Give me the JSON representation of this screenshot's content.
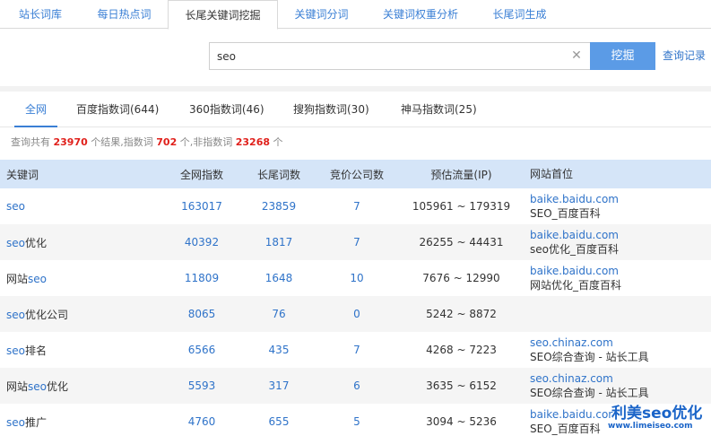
{
  "top_tabs": [
    {
      "label": "站长词库",
      "active": false
    },
    {
      "label": "每日热点词",
      "active": false
    },
    {
      "label": "长尾关键词挖掘",
      "active": true
    },
    {
      "label": "关键词分词",
      "active": false
    },
    {
      "label": "关键词权重分析",
      "active": false
    },
    {
      "label": "长尾词生成",
      "active": false
    }
  ],
  "search": {
    "value": "seo",
    "button_label": "挖掘",
    "history_label": "查询记录"
  },
  "sub_tabs": [
    {
      "label": "全网",
      "active": true
    },
    {
      "label": "百度指数词(644)",
      "active": false
    },
    {
      "label": "360指数词(46)",
      "active": false
    },
    {
      "label": "搜狗指数词(30)",
      "active": false
    },
    {
      "label": "神马指数词(25)",
      "active": false
    }
  ],
  "summary": {
    "prefix": "查询共有",
    "total": "23970",
    "mid1": "个结果,指数词",
    "index_count": "702",
    "mid2": "个,非指数词",
    "non_index_count": "23268",
    "suffix": "个"
  },
  "table": {
    "headers": [
      "关键词",
      "全网指数",
      "长尾词数",
      "竞价公司数",
      "预估流量(IP)",
      "网站首位"
    ],
    "rows": [
      {
        "kw_pre": "",
        "kw_hl": "seo",
        "kw_post": "",
        "index": "163017",
        "longtail": "23859",
        "bid": "7",
        "flow": "105961 ~ 179319",
        "domain": "baike.baidu.com",
        "site_title": "SEO_百度百科"
      },
      {
        "kw_pre": "",
        "kw_hl": "seo",
        "kw_post": "优化",
        "index": "40392",
        "longtail": "1817",
        "bid": "7",
        "flow": "26255 ~ 44431",
        "domain": "baike.baidu.com",
        "site_title": "seo优化_百度百科"
      },
      {
        "kw_pre": "网站",
        "kw_hl": "seo",
        "kw_post": "",
        "index": "11809",
        "longtail": "1648",
        "bid": "10",
        "flow": "7676 ~ 12990",
        "domain": "baike.baidu.com",
        "site_title": "网站优化_百度百科"
      },
      {
        "kw_pre": "",
        "kw_hl": "seo",
        "kw_post": "优化公司",
        "index": "8065",
        "longtail": "76",
        "bid": "0",
        "flow": "5242 ~ 8872",
        "domain": "",
        "site_title": ""
      },
      {
        "kw_pre": "",
        "kw_hl": "seo",
        "kw_post": "排名",
        "index": "6566",
        "longtail": "435",
        "bid": "7",
        "flow": "4268 ~ 7223",
        "domain": "seo.chinaz.com",
        "site_title": "SEO综合查询 - 站长工具"
      },
      {
        "kw_pre": "网站",
        "kw_hl": "seo",
        "kw_post": "优化",
        "index": "5593",
        "longtail": "317",
        "bid": "6",
        "flow": "3635 ~ 6152",
        "domain": "seo.chinaz.com",
        "site_title": "SEO综合查询 - 站长工具"
      },
      {
        "kw_pre": "",
        "kw_hl": "seo",
        "kw_post": "推广",
        "index": "4760",
        "longtail": "655",
        "bid": "5",
        "flow": "3094 ~ 5236",
        "domain": "baike.baidu.com",
        "site_title": "SEO_百度百科"
      }
    ]
  },
  "watermark": {
    "title": "利美seo优化",
    "url": "www.limeiseo.com"
  },
  "colors": {
    "accent": "#3a7fd5",
    "button": "#5b9be6",
    "header_bg": "#d5e5f8",
    "highlight_red": "#e0201b"
  }
}
